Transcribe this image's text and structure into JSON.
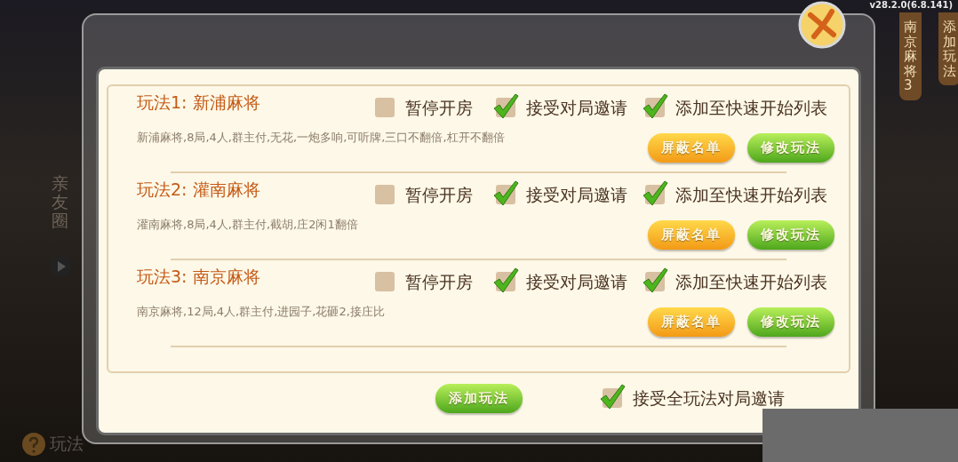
{
  "background": {
    "version": "v28.2.0(6.8.141)",
    "side_tab": "亲友圈",
    "help_label": "玩法",
    "right_tabs": [
      "南京麻将3",
      "添加玩法"
    ]
  },
  "dialog": {
    "rules": [
      {
        "title": "玩法1: 新浦麻将",
        "description": "新浦麻将,8局,4人,群主付,无花,一炮多响,可听牌,三口不翻倍,杠开不翻倍",
        "options": [
          {
            "label": "暂停开房",
            "checked": false
          },
          {
            "label": "接受对局邀请",
            "checked": true
          },
          {
            "label": "添加至快速开始列表",
            "checked": true
          }
        ],
        "buttons": [
          "屏蔽名单",
          "修改玩法"
        ]
      },
      {
        "title": "玩法2: 灌南麻将",
        "description": "灌南麻将,8局,4人,群主付,截胡,庄2闲1翻倍",
        "options": [
          {
            "label": "暂停开房",
            "checked": false
          },
          {
            "label": "接受对局邀请",
            "checked": true
          },
          {
            "label": "添加至快速开始列表",
            "checked": true
          }
        ],
        "buttons": [
          "屏蔽名单",
          "修改玩法"
        ]
      },
      {
        "title": "玩法3: 南京麻将",
        "description": "南京麻将,12局,4人,群主付,进园子,花砸2,接庄比",
        "options": [
          {
            "label": "暂停开房",
            "checked": false
          },
          {
            "label": "接受对局邀请",
            "checked": true
          },
          {
            "label": "添加至快速开始列表",
            "checked": true
          }
        ],
        "buttons": [
          "屏蔽名单",
          "修改玩法"
        ]
      }
    ],
    "add_button": "添加玩法",
    "accept_all": {
      "label": "接受全玩法对局邀请",
      "checked": true
    }
  }
}
